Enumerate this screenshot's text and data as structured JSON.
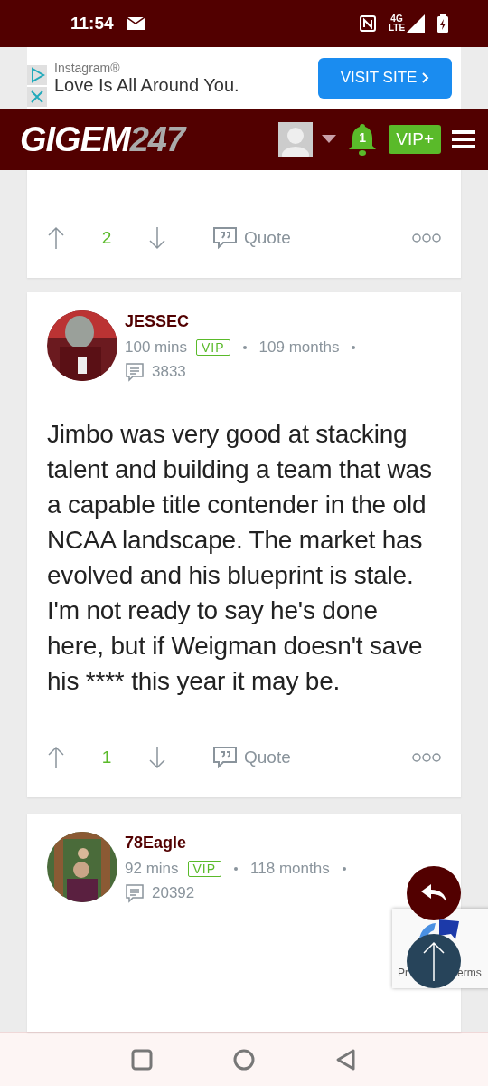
{
  "status_bar": {
    "time": "11:54",
    "network": "4G LTE"
  },
  "ad": {
    "advertiser": "Instagram®",
    "headline": "Love Is All Around You.",
    "button": "VISIT SITE"
  },
  "header": {
    "logo_main": "GIGEM",
    "logo_accent": "247",
    "notifications": "1",
    "vip_button": "VIP+"
  },
  "posts": [
    {
      "kind": "partial",
      "votes": "2",
      "quote": "Quote"
    },
    {
      "kind": "full",
      "username": "JESSEC",
      "time": "100 mins",
      "badge": "VIP",
      "tenure": "109 months",
      "comments": "3833",
      "body": "Jimbo was very good at stacking talent and building a team that was a capable title contender in the old NCAA landscape. The market has evolved and his blueprint is stale. I'm not ready to say he's done here, but if Weigman doesn't save his **** this year it may be.",
      "votes": "1",
      "quote": "Quote"
    },
    {
      "kind": "header",
      "username": "78Eagle",
      "time": "92 mins",
      "badge": "VIP",
      "tenure": "118 months",
      "comments": "20392"
    }
  ],
  "recaptcha": {
    "links": [
      "Pr",
      "erms"
    ]
  }
}
